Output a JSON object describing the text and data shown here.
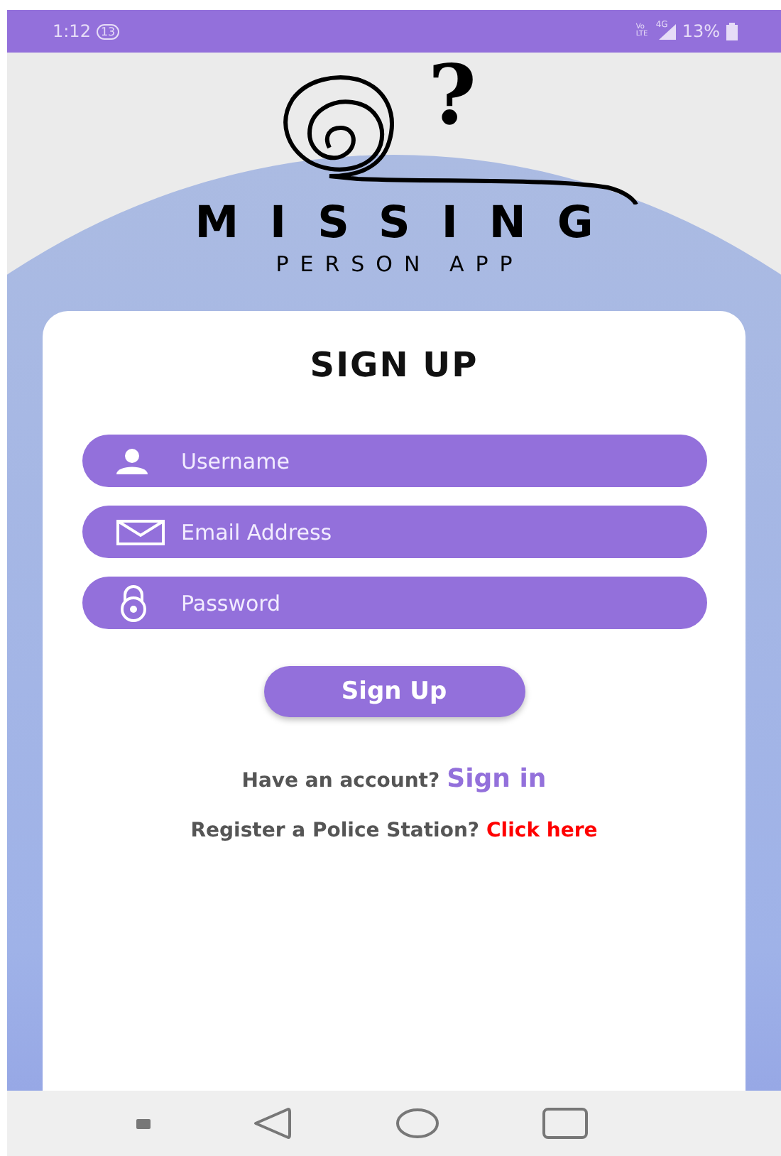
{
  "status_bar": {
    "time": "1:12",
    "notification_count": "13",
    "volte": "Vo LTE",
    "network": "4G",
    "battery": "13%"
  },
  "logo": {
    "mark": "?",
    "title": "MISSING",
    "subtitle": "PERSON APP"
  },
  "form": {
    "title": "SIGN UP",
    "fields": [
      {
        "kind": "user",
        "placeholder": "Username"
      },
      {
        "kind": "email",
        "placeholder": "Email Address"
      },
      {
        "kind": "password",
        "placeholder": "Password"
      }
    ],
    "submit": "Sign Up",
    "signin_prompt": "Have an account?",
    "signin_link": "Sign in",
    "register_prompt": "Register a Police Station?",
    "register_link": "Click here"
  },
  "nav_bar": [
    {
      "kind": "menu"
    },
    {
      "kind": "back"
    },
    {
      "kind": "home"
    },
    {
      "kind": "recents"
    }
  ]
}
